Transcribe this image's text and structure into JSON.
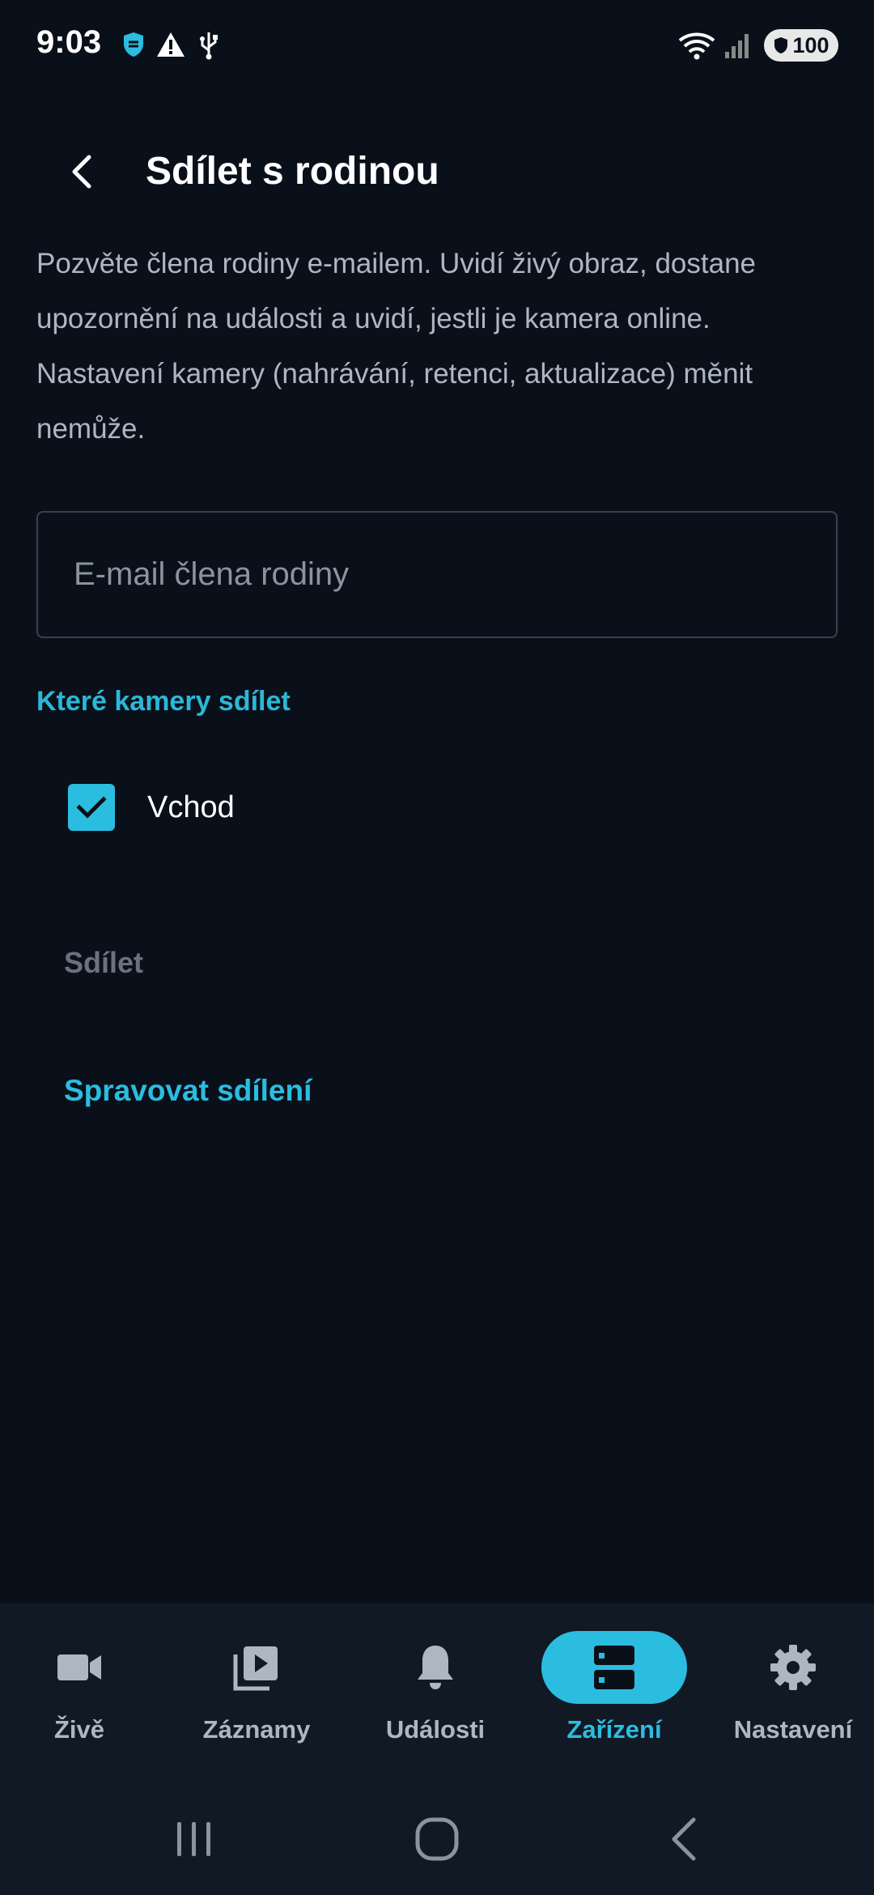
{
  "status_bar": {
    "time": "9:03",
    "battery": "100",
    "icons": [
      "shield-icon",
      "warning-icon",
      "usb-icon",
      "wifi-icon",
      "signal-icon",
      "battery-icon"
    ]
  },
  "header": {
    "title": "Sdílet s rodinou",
    "back_icon": "chevron-left-icon"
  },
  "description": "Pozvěte člena rodiny e-mailem. Uvidí živý obraz, dostane upozornění na události a uvidí, jestli je kamera online. Nastavení kamery (nahrávání, retenci, aktualizace) měnit nemůže.",
  "email_field": {
    "placeholder": "E-mail člena rodiny",
    "value": ""
  },
  "cameras_section": {
    "label": "Které kamery sdílet",
    "items": [
      {
        "label": "Vchod",
        "checked": true
      }
    ]
  },
  "actions": {
    "share_label": "Sdílet",
    "manage_label": "Spravovat sdílení"
  },
  "bottom_nav": {
    "items": [
      {
        "label": "Živě",
        "icon": "video-camera-icon",
        "active": false
      },
      {
        "label": "Záznamy",
        "icon": "playlist-play-icon",
        "active": false
      },
      {
        "label": "Události",
        "icon": "bell-icon",
        "active": false
      },
      {
        "label": "Zařízení",
        "icon": "devices-icon",
        "active": true
      },
      {
        "label": "Nastavení",
        "icon": "gear-icon",
        "active": false
      }
    ]
  },
  "colors": {
    "background": "#0a101a",
    "accent": "#2bbde0",
    "nav_background": "#111925",
    "muted_text": "#aeb6c2",
    "disabled_text": "#6b727d"
  }
}
